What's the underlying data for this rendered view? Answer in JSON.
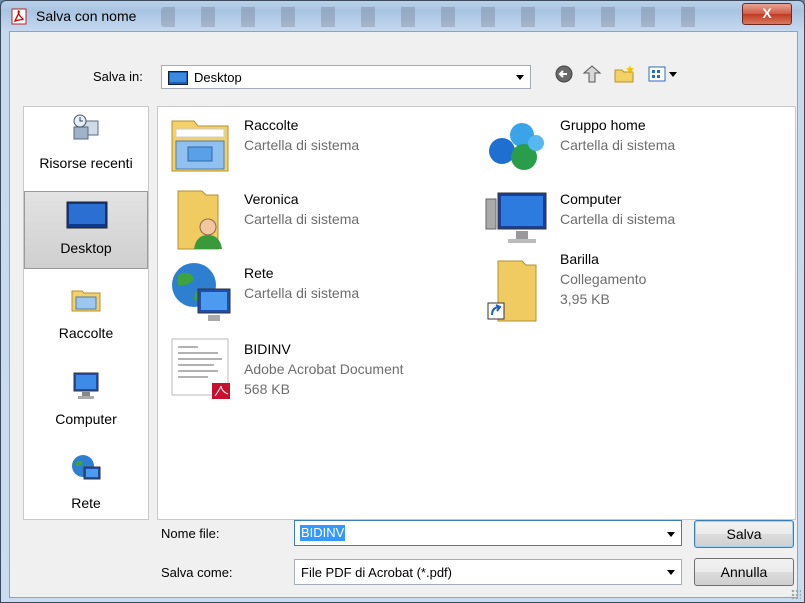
{
  "window": {
    "title": "Salva con nome",
    "close_label": "X"
  },
  "location": {
    "label": "Salva in:",
    "value": "Desktop"
  },
  "toolbar": {
    "back_icon": "back-arrow-icon",
    "up_icon": "up-folder-icon",
    "new_folder_icon": "new-folder-icon",
    "views_icon": "view-menu-icon"
  },
  "places": [
    {
      "label": "Risorse recenti",
      "icon": "recent-places-icon"
    },
    {
      "label": "Desktop",
      "icon": "desktop-icon",
      "selected": true
    },
    {
      "label": "Raccolte",
      "icon": "libraries-icon"
    },
    {
      "label": "Computer",
      "icon": "computer-icon"
    },
    {
      "label": "Rete",
      "icon": "network-icon"
    }
  ],
  "items": [
    {
      "name": "Raccolte",
      "line1": "Cartella di sistema",
      "line2": "",
      "icon": "libraries-icon"
    },
    {
      "name": "Gruppo home",
      "line1": "Cartella di sistema",
      "line2": "",
      "icon": "homegroup-icon"
    },
    {
      "name": "Veronica",
      "line1": "Cartella di sistema",
      "line2": "",
      "icon": "user-folder-icon"
    },
    {
      "name": "Computer",
      "line1": "Cartella di sistema",
      "line2": "",
      "icon": "computer-icon"
    },
    {
      "name": "Rete",
      "line1": "Cartella di sistema",
      "line2": "",
      "icon": "network-icon"
    },
    {
      "name": "Barilla",
      "line1": "Collegamento",
      "line2": "3,95 KB",
      "icon": "folder-shortcut-icon"
    },
    {
      "name": "BIDINV",
      "line1": "Adobe Acrobat Document",
      "line2": "568 KB",
      "icon": "pdf-document-icon"
    }
  ],
  "filename": {
    "label": "Nome file:",
    "value": "BIDINV"
  },
  "filetype": {
    "label": "Salva come:",
    "value": "File PDF di Acrobat (*.pdf)"
  },
  "buttons": {
    "save": "Salva",
    "cancel": "Annulla"
  }
}
